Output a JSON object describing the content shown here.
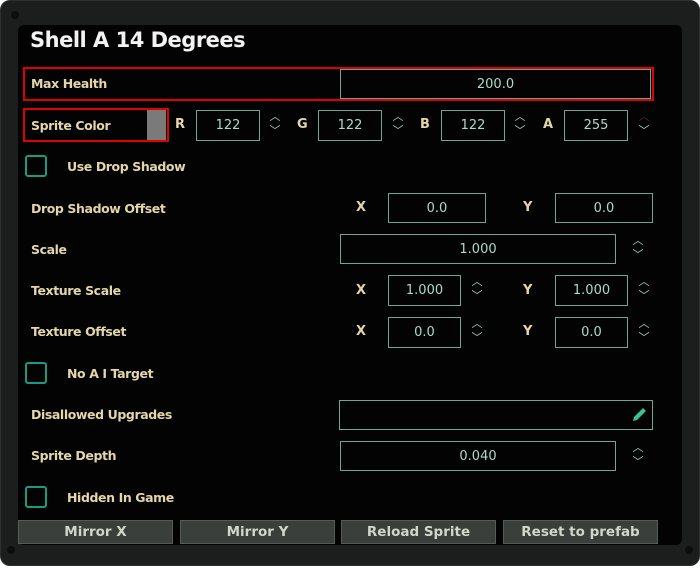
{
  "title": "Shell A 14 Degrees",
  "max_health": {
    "label": "Max Health",
    "value": "200.0"
  },
  "sprite_color": {
    "label": "Sprite Color",
    "swatch": "#7a7a7a",
    "r_label": "R",
    "r": "122",
    "g_label": "G",
    "g": "122",
    "b_label": "B",
    "b": "122",
    "a_label": "A",
    "a": "255"
  },
  "use_drop_shadow": {
    "label": "Use Drop Shadow",
    "checked": false
  },
  "drop_shadow_offset": {
    "label": "Drop Shadow Offset",
    "x_label": "X",
    "x": "0.0",
    "y_label": "Y",
    "y": "0.0"
  },
  "scale": {
    "label": "Scale",
    "value": "1.000"
  },
  "texture_scale": {
    "label": "Texture Scale",
    "x_label": "X",
    "x": "1.000",
    "y_label": "Y",
    "y": "1.000"
  },
  "texture_offset": {
    "label": "Texture Offset",
    "x_label": "X",
    "x": "0.0",
    "y_label": "Y",
    "y": "0.0"
  },
  "no_ai_target": {
    "label": "No A I Target",
    "checked": false
  },
  "disallowed_upgrades": {
    "label": "Disallowed Upgrades",
    "value": ""
  },
  "sprite_depth": {
    "label": "Sprite Depth",
    "value": "0.040"
  },
  "hidden_in_game": {
    "label": "Hidden In Game",
    "checked": false
  },
  "buttons": {
    "mirror_x": "Mirror X",
    "mirror_y": "Mirror Y",
    "reload": "Reload Sprite",
    "reset": "Reset to prefab"
  },
  "glyphs": {
    "up": "︿",
    "down": "﹀"
  },
  "colors": {
    "label": "#e3d6aa",
    "value": "#a9dcc8",
    "highlight": "#e00000"
  }
}
